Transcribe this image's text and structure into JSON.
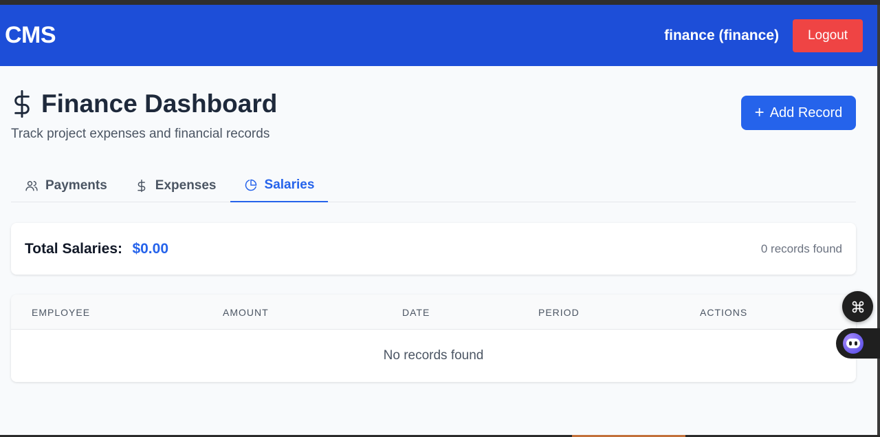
{
  "app": {
    "brand": "CMS"
  },
  "navbar": {
    "user": "finance (finance)",
    "logout_label": "Logout"
  },
  "page": {
    "title": "Finance Dashboard",
    "subtitle": "Track project expenses and financial records",
    "add_button_label": "Add Record"
  },
  "tabs": [
    {
      "label": "Payments",
      "icon": "users-icon",
      "active": false
    },
    {
      "label": "Expenses",
      "icon": "dollar-icon",
      "active": false
    },
    {
      "label": "Salaries",
      "icon": "pie-chart-icon",
      "active": true
    }
  ],
  "summary": {
    "label": "Total Salaries:",
    "value": "$0.00",
    "records": "0 records found"
  },
  "table": {
    "columns": [
      "EMPLOYEE",
      "AMOUNT",
      "DATE",
      "PERIOD",
      "ACTIONS"
    ],
    "empty_text": "No records found"
  },
  "colors": {
    "navbar": "#1d4ed8",
    "primary": "#2563eb",
    "logout": "#ef4444"
  }
}
